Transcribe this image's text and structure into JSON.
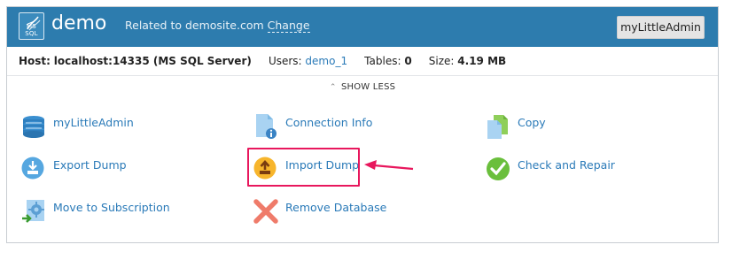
{
  "header": {
    "logo_text": "MS SQL",
    "title": "demo",
    "related_prefix": "Related to demosite.com",
    "change_link": "Change",
    "admin_button": "myLittleAdmin"
  },
  "info": {
    "host_label": "Host:",
    "host_value": "localhost:14335 (MS SQL Server)",
    "users_label": "Users:",
    "users_value": "demo_1",
    "tables_label": "Tables:",
    "tables_value": "0",
    "size_label": "Size:",
    "size_value": "4.19 MB"
  },
  "toggle": {
    "label": "SHOW LESS"
  },
  "actions": [
    {
      "label": "myLittleAdmin",
      "icon": "database-stack-icon"
    },
    {
      "label": "Connection Info",
      "icon": "document-info-icon"
    },
    {
      "label": "Copy",
      "icon": "copy-documents-icon"
    },
    {
      "label": "Export Dump",
      "icon": "export-download-icon"
    },
    {
      "label": "Import Dump",
      "icon": "import-upload-icon"
    },
    {
      "label": "Check and Repair",
      "icon": "checkmark-icon"
    },
    {
      "label": "Move to Subscription",
      "icon": "move-gear-icon"
    },
    {
      "label": "Remove Database",
      "icon": "remove-x-icon"
    }
  ],
  "colors": {
    "header_bg": "#2d7cae",
    "link": "#2a7ab8",
    "highlight": "#e8175d"
  }
}
